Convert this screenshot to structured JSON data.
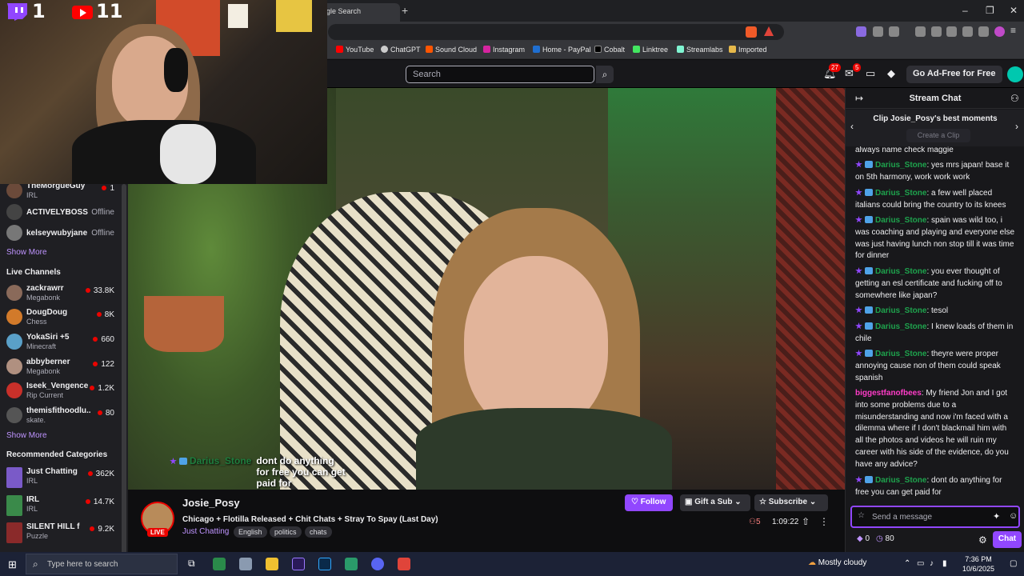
{
  "browser": {
    "tab_title": "gle Search",
    "new_tab": "+",
    "window_controls": [
      "–",
      "❐",
      "✕"
    ],
    "bookmarks": [
      {
        "label": "YouTube",
        "color": "#ff0000"
      },
      {
        "label": "ChatGPT",
        "color": "#cccccc"
      },
      {
        "label": "Sound Cloud",
        "color": "#ff5500"
      },
      {
        "label": "Instagram",
        "color": "#d6249f"
      },
      {
        "label": "Home - PayPal",
        "color": "#1f6fd1"
      },
      {
        "label": "Cobalt",
        "color": "#000000"
      },
      {
        "label": "Linktree",
        "color": "#43e660"
      },
      {
        "label": "Streamlabs",
        "color": "#80f5d2"
      },
      {
        "label": "Imported",
        "color": "#e6b84a"
      }
    ]
  },
  "topnav": {
    "search_placeholder": "Search",
    "search_icon": "search-icon",
    "notifications_count": "27",
    "inbox_count": "5",
    "ad_free_label": "Go Ad-Free for Free"
  },
  "webcam": {
    "twitch_count": "1",
    "youtube_count": "11"
  },
  "sidebar": {
    "followed": [
      {
        "name": "TheMorgueGuy",
        "game": "IRL",
        "viewers": "1",
        "avatar": "#6b4a3a"
      },
      {
        "name": "ACTIVELYBOSS",
        "status": "Offline",
        "avatar": "#444"
      },
      {
        "name": "kelseywubyjane",
        "status": "Offline",
        "avatar": "#777"
      }
    ],
    "show_more_1": "Show More",
    "live_heading": "Live Channels",
    "live": [
      {
        "name": "zackrawrr",
        "game": "Megabonk",
        "viewers": "33.8K",
        "avatar": "#8a6a5a"
      },
      {
        "name": "DougDoug",
        "game": "Chess",
        "viewers": "8K",
        "avatar": "#d27a2a"
      },
      {
        "name": "YokaSiri +5",
        "game": "Minecraft",
        "viewers": "660",
        "avatar": "#5aa0c8"
      },
      {
        "name": "abbyberner",
        "game": "Megabonk",
        "viewers": "122",
        "avatar": "#b09080"
      },
      {
        "name": "Iseek_Vengence",
        "game": "Rip Current",
        "viewers": "1.2K",
        "avatar": "#c8302a"
      },
      {
        "name": "themisfithoodlu...",
        "game": "skate.",
        "viewers": "80",
        "avatar": "#555"
      }
    ],
    "show_more_2": "Show More",
    "rec_heading": "Recommended Categories",
    "categories": [
      {
        "name": "Just Chatting",
        "tag": "IRL",
        "viewers": "362K",
        "color": "#7a5ac8"
      },
      {
        "name": "IRL",
        "tag": "IRL",
        "viewers": "14.7K",
        "color": "#3a8a4a"
      },
      {
        "name": "SILENT HILL f",
        "tag": "Puzzle",
        "viewers": "9.2K",
        "color": "#8a2a2a"
      }
    ]
  },
  "video": {
    "caption_user": "Darius_Stone",
    "caption_text": "dont do anything for free you can get paid for"
  },
  "channel": {
    "name": "Josie_Posy",
    "live": "LIVE",
    "title": "Chicago + Flotilla Released + Chit Chats + Stray To Spay (Last Day)",
    "category": "Just Chatting",
    "tags": [
      "English",
      "politics",
      "chats"
    ],
    "follow": "Follow",
    "gift_sub": "Gift a Sub",
    "subscribe": "Subscribe",
    "viewers": "5",
    "uptime": "1:09:22"
  },
  "chat": {
    "title": "Stream Chat",
    "clip_title": "Clip Josie_Posy's best moments",
    "create_clip": "Create a Clip",
    "messages": [
      {
        "user": "",
        "text": "always name check maggie",
        "color": "#efeff1",
        "badges": false
      },
      {
        "user": "Darius_Stone",
        "text": ": yes mrs japan! base it on 5th harmony, work work work",
        "color": "#1ea34d",
        "badges": true
      },
      {
        "user": "Darius_Stone",
        "text": ": a few well placed italians could bring the country to its knees",
        "color": "#1ea34d",
        "badges": true
      },
      {
        "user": "Darius_Stone",
        "text": ": spain was wild too, i was coaching and playing and everyone else was just having lunch non stop till it was time for dinner",
        "color": "#1ea34d",
        "badges": true
      },
      {
        "user": "Darius_Stone",
        "text": ": you ever thought of getting an esl certificate and fucking off to somewhere like japan?",
        "color": "#1ea34d",
        "badges": true
      },
      {
        "user": "Darius_Stone",
        "text": ": tesol",
        "color": "#1ea34d",
        "badges": true
      },
      {
        "user": "Darius_Stone",
        "text": ": I knew loads of them in chile",
        "color": "#1ea34d",
        "badges": true
      },
      {
        "user": "Darius_Stone",
        "text": ": theyre were proper annoying cause non of them could speak spanish",
        "color": "#1ea34d",
        "badges": true
      },
      {
        "user": "biggestfanofbees",
        "text": ": My friend Jon and I got into some problems due to a misunderstanding and now i'm faced with a dilemma where if I don't blackmail him with all the photos and videos he will ruin my career with his side of the evidence, do you have any advice?",
        "color": "#ff3cc8",
        "badges": false
      },
      {
        "user": "Darius_Stone",
        "text": ": dont do anything for free you can get paid for",
        "color": "#1ea34d",
        "badges": true
      }
    ],
    "input_placeholder": "Send a message",
    "points": "0",
    "bits": "80",
    "send": "Chat"
  },
  "taskbar": {
    "search_placeholder": "Type here to search",
    "weather": "Mostly cloudy",
    "time": "7:36 PM",
    "date": "10/6/2025"
  }
}
